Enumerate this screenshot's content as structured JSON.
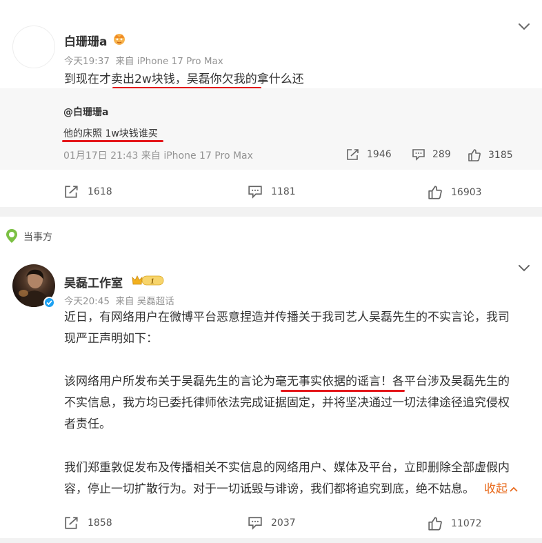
{
  "post1": {
    "author": "白珊珊a",
    "time": "今天19:37",
    "source": "来自 iPhone 17 Pro Max",
    "text": "到现在才卖出2w块钱，吴磊你欠我的拿什么还",
    "quote": {
      "user": "@白珊珊a",
      "text": "他的床照 1w块钱谁买",
      "meta": "01月17日 21:43 来自 iPhone 17 Pro Max",
      "reposts": "1946",
      "comments": "289",
      "likes": "3185"
    },
    "reposts": "1618",
    "comments": "1181",
    "likes": "16903"
  },
  "party_label": "当事方",
  "post2": {
    "author": "吴磊工作室",
    "badge_level": "1",
    "time": "今天20:45",
    "source": "来自 吴磊超话",
    "para1_line1": "近日，有网络用户在微博平台恶意捏造并传播关于我司艺人吴磊先生的不实言论，我司",
    "para1_line2": "现严正声明如下：",
    "para2_line1": "该网络用户所发布关于吴磊先生的言论为毫无事实依据的谣言！各平台涉及吴磊先生的",
    "para2_line2": "不实信息，我方均已委托律师依法完成证据固定，并将坚决通过一切法律途径追究侵权",
    "para2_line3": "者责任。",
    "para3_line1": "我们郑重敦促发布及传播相关不实信息的网络用户、媒体及平台，立即删除全部虚假内",
    "para3_line2": "容，停止一切扩散行为。对于一切诋毁与诽谤，我们都将追究到底，绝不姑息。",
    "collapse_label": "收起",
    "reposts": "1858",
    "comments": "2037",
    "likes": "11072"
  },
  "icons": {
    "repost": "share-arrow-icon",
    "comment": "comment-bubble-icon",
    "like": "thumbs-up-icon",
    "more": "chevron-down-icon",
    "crown": "crown-badge-icon",
    "pin": "location-pin-icon"
  },
  "colors": {
    "accent_orange": "#e86a1c",
    "underline_red": "#e4161a",
    "verified_blue": "#1da1f2",
    "party_green": "#7bc043"
  }
}
